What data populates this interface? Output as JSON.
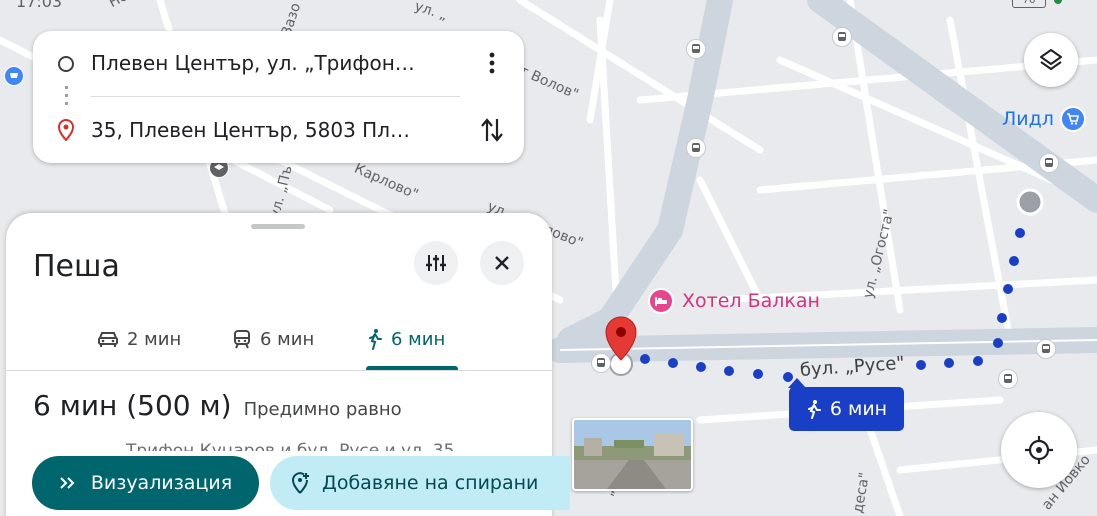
{
  "status_bar": {
    "time": "17:03",
    "battery": "76"
  },
  "route": {
    "origin": "Плевен Център, ул. „Трифон…",
    "destination": "35, Плевен Център, 5803 Пл…"
  },
  "panel": {
    "title": "Пеша",
    "tabs": [
      {
        "label": "2 мин",
        "icon": "car-icon"
      },
      {
        "label": "6 мин",
        "icon": "train-icon"
      },
      {
        "label": "6 мин",
        "icon": "walk-icon",
        "active": true
      }
    ],
    "summary_time": "6 мин (500 м)",
    "summary_note": "Предимно равно",
    "via_text": "Трифон Куцаров и бул. Русе и ул. 35",
    "preview_button": "Визуализация",
    "add_stops_button": "Добавяне на спирани"
  },
  "map": {
    "labels": {
      "street_volov": "т Волов\"",
      "street_karlovo1": "Карлово\"",
      "street_karlovo2": "ул. „Карлово\"",
      "street_ogosta": "ул. „Огоста\"",
      "street_ruse": "бул. „Русе\"",
      "street_neof": "Неоф",
      "street_ul_top": "ул. „",
      "street_vaz": "Вазо",
      "street_bgnl": "ул. „Пъ",
      "street_odesa": "деса\"",
      "street_yovk": "ан Йовко",
      "street_bottom_m": "„М"
    },
    "hotel": "Хотел Балкан",
    "store": "Лидл",
    "route_badge": "6 мин",
    "colors": {
      "route": "#1a3fc7",
      "teal": "#00656d",
      "hotel": "#d6317f"
    }
  }
}
